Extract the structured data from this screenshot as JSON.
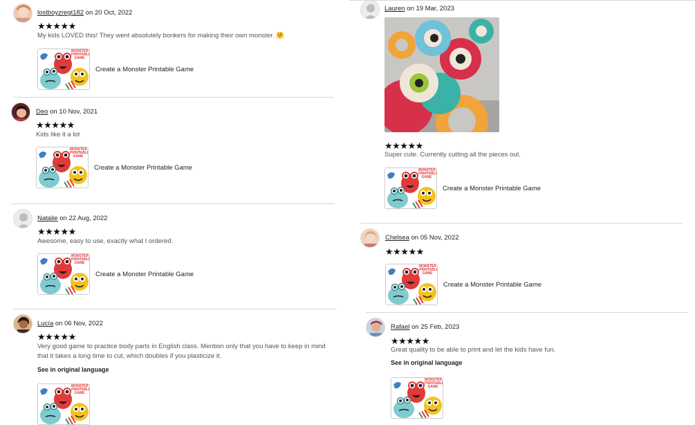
{
  "product_title": "Create a Monster Printable Game",
  "thumb_caption": [
    "MONSTER",
    "PRINTABLE",
    "GAME"
  ],
  "see_original": "See in original language",
  "on_word": "on",
  "reviews": [
    {
      "name": "lostboyzregt182",
      "date": "20 Oct, 2022",
      "stars": "★★★★★",
      "text": "My kids LOVED this! They went absolutely bonkers for making their own monster. 🤗"
    },
    {
      "name": "Deo",
      "date": "10 Nov, 2021",
      "stars": "★★★★★",
      "text": "Kids like it a lot"
    },
    {
      "name": "Natalie",
      "date": "22 Aug, 2022",
      "stars": "★★★★★",
      "text": "Awesome, easy to use, exactly what I ordered."
    },
    {
      "name": "Lucía",
      "date": "06 Nov, 2022",
      "stars": "★★★★★",
      "text": "Very good game to practice body parts in English class. Mention only that you have to keep in mind that it takes a long time to cut, which doubles if you plasticize it."
    },
    {
      "name": "Lauren",
      "date": "19 Mar, 2023",
      "stars": "★★★★★",
      "text": "Super cute. Currently cutting all the pieces out."
    },
    {
      "name": "Chelsea",
      "date": "05 Nov, 2022",
      "stars": "★★★★★",
      "text": ""
    },
    {
      "name": "Rafael",
      "date": "25 Feb, 2023",
      "stars": "★★★★★",
      "text": "Great quality to be able to print and let the kids have fun."
    }
  ]
}
